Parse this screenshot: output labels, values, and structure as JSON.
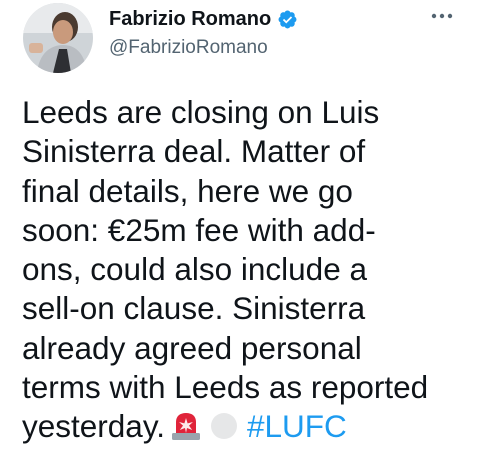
{
  "author": {
    "display_name": "Fabrizio Romano",
    "handle": "@FabrizioRomano",
    "verified": true,
    "verified_icon": "verified-badge-icon",
    "avatar_icon": "profile-avatar"
  },
  "menu": {
    "icon": "more-options-icon"
  },
  "tweet": {
    "lines": [
      "Leeds are closing on Luis",
      "Sinisterra deal. Matter of",
      "final details, here we go",
      "soon: €25m fee with add-",
      "ons, could also include a",
      "sell-on clause. Sinisterra",
      "already agreed personal",
      "terms with Leeds as reported",
      "yesterday."
    ],
    "emojis": [
      "siren-emoji",
      "white-circle-emoji"
    ],
    "hashtag": "#LUFC"
  },
  "colors": {
    "text": "#0f1419",
    "secondary": "#536471",
    "link": "#1d9bf0",
    "verified": "#1d9bf0",
    "siren": "#e0243a"
  }
}
